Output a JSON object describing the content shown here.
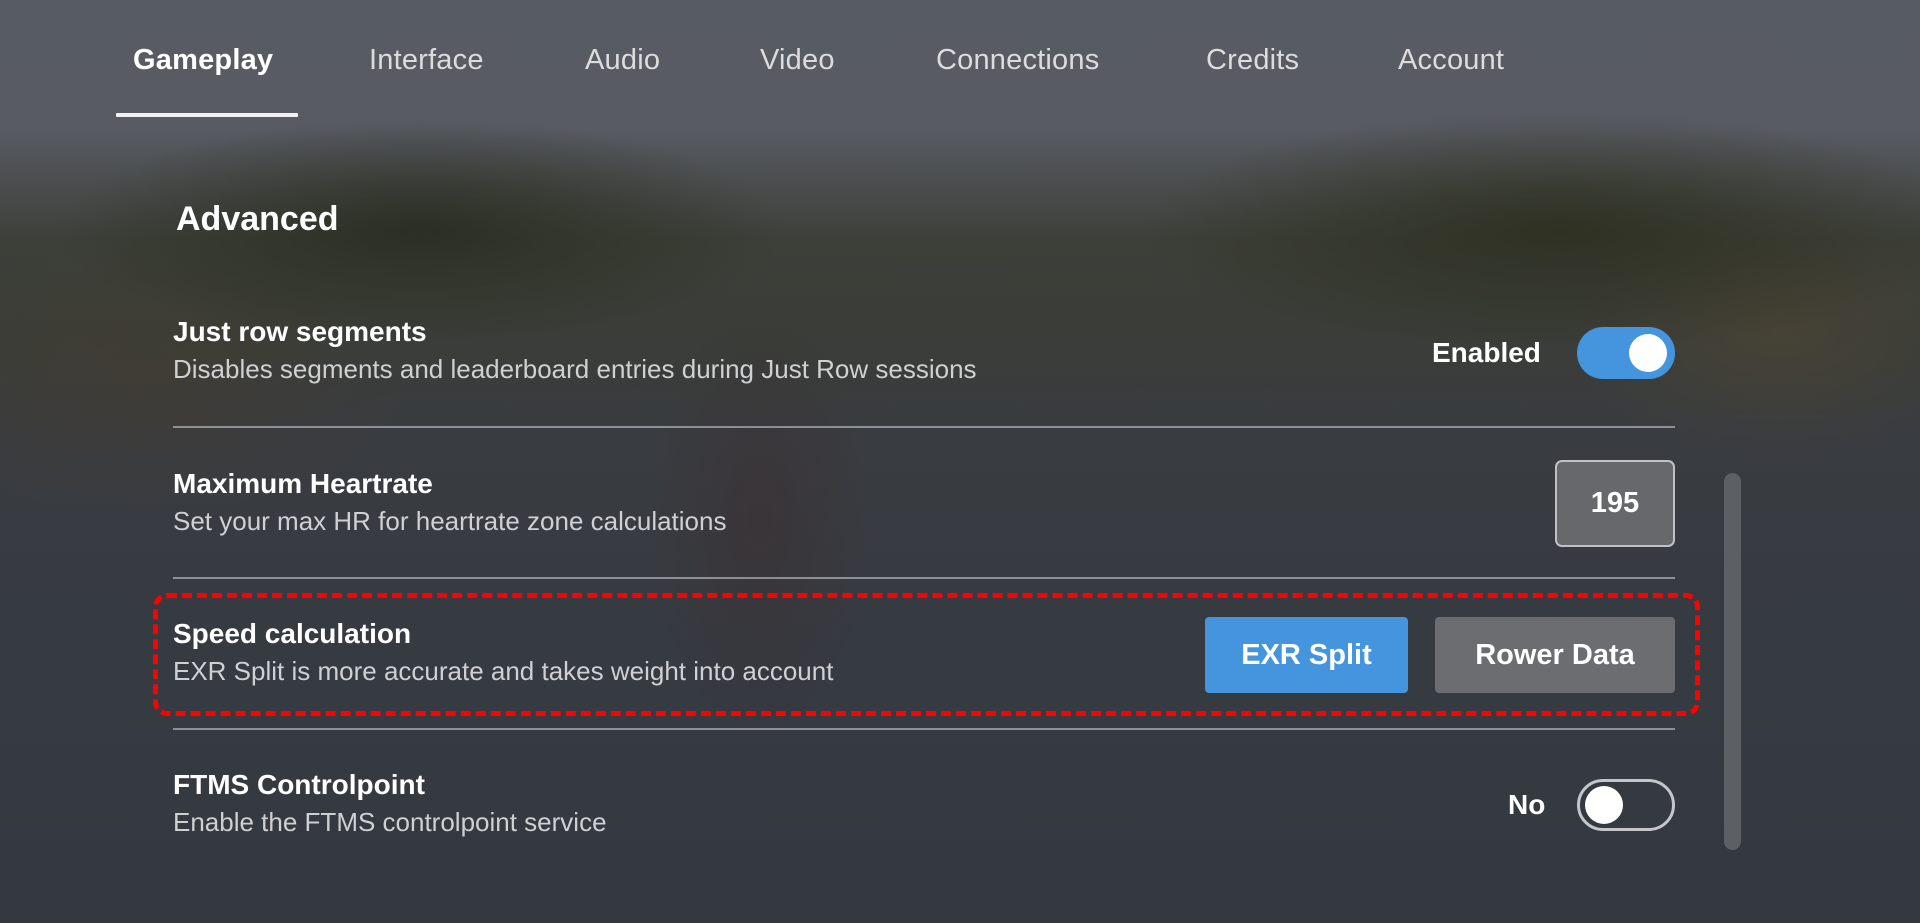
{
  "tabs": [
    {
      "label": "Gameplay",
      "active": true
    },
    {
      "label": "Interface",
      "active": false
    },
    {
      "label": "Audio",
      "active": false
    },
    {
      "label": "Video",
      "active": false
    },
    {
      "label": "Connections",
      "active": false
    },
    {
      "label": "Credits",
      "active": false
    },
    {
      "label": "Account",
      "active": false
    }
  ],
  "section": {
    "title": "Advanced"
  },
  "settings": {
    "just_row_segments": {
      "title": "Just row segments",
      "description": "Disables segments and leaderboard entries during Just Row sessions",
      "state_label": "Enabled",
      "enabled": true
    },
    "max_heartrate": {
      "title": "Maximum Heartrate",
      "description": "Set your max HR for heartrate zone calculations",
      "value": "195"
    },
    "speed_calculation": {
      "title": "Speed calculation",
      "description": "EXR Split is more accurate and takes weight into account",
      "options": [
        {
          "label": "EXR Split",
          "selected": true
        },
        {
          "label": "Rower Data",
          "selected": false
        }
      ]
    },
    "ftms_controlpoint": {
      "title": "FTMS Controlpoint",
      "description": "Enable the FTMS controlpoint service",
      "state_label": "No",
      "enabled": false
    }
  },
  "colors": {
    "accent": "#4495dd",
    "unselected_button": "#6b6d70",
    "highlight": "#ff0000"
  }
}
